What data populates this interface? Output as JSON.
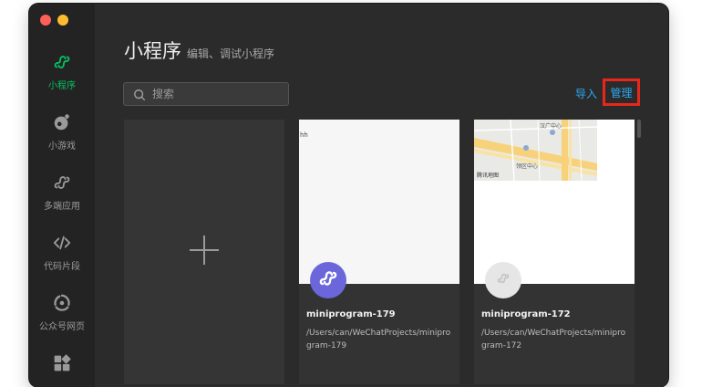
{
  "sidebar": {
    "items": [
      {
        "label": "小程序",
        "icon": "miniprogram-icon",
        "active": true
      },
      {
        "label": "小游戏",
        "icon": "minigame-icon",
        "active": false
      },
      {
        "label": "多端应用",
        "icon": "multiplatform-icon",
        "active": false
      },
      {
        "label": "代码片段",
        "icon": "code-snippet-icon",
        "active": false
      },
      {
        "label": "公众号网页",
        "icon": "official-account-icon",
        "active": false
      },
      {
        "label": "",
        "icon": "more-apps-icon",
        "active": false
      }
    ]
  },
  "header": {
    "title": "小程序",
    "subtitle": "编辑、调试小程序"
  },
  "search": {
    "placeholder": "搜索"
  },
  "actions": {
    "import_label": "导入",
    "manage_label": "管理"
  },
  "projects": [
    {
      "name": "miniprogram-179",
      "path": "/Users/can/WeChatProjects/miniprogram-179",
      "preview_text": "hh"
    },
    {
      "name": "miniprogram-172",
      "path": "/Users/can/WeChatProjects/miniprogram-172",
      "map_labels": [
        "汉广中心",
        "领区中心",
        "腾讯地图"
      ]
    }
  ],
  "colors": {
    "accent_green": "#07c160",
    "link_blue": "#2ca9f2",
    "highlight_red": "#e8271b",
    "avatar_purple": "#6b66d9"
  }
}
